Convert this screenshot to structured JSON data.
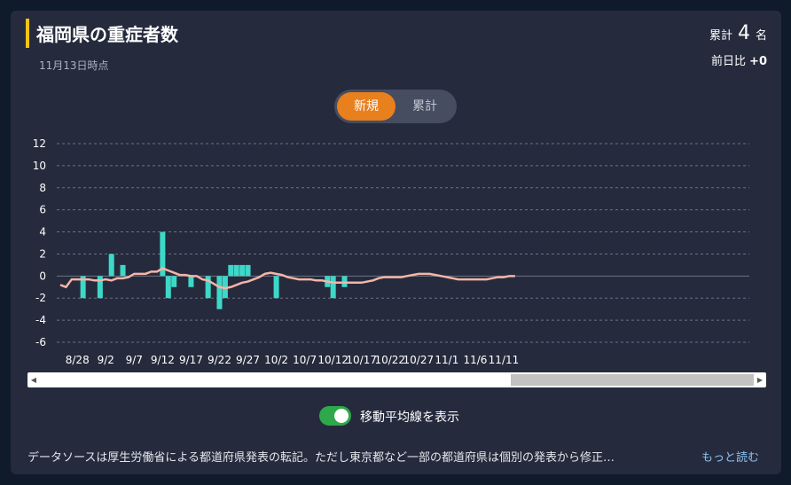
{
  "header": {
    "title": "福岡県の重症者数",
    "as_of": "11月13日時点",
    "total_label": "累計",
    "total_value": "4",
    "total_unit": "名",
    "day_diff_label": "前日比",
    "day_diff_value": "+0"
  },
  "tabs": {
    "new_label": "新規",
    "cumulative_label": "累計",
    "selected": "新規"
  },
  "moving_average": {
    "label": "移動平均線を表示",
    "enabled": true
  },
  "footer": {
    "note": "データソースは厚生労働省による都道府県発表の転記。ただし東京都など一部の都道府県は個別の発表から修正…",
    "read_more": "もっと読む"
  },
  "colors": {
    "bar": "#3dd9c8",
    "moving_average": "#f4b5a8",
    "accent": "#f0c419",
    "tab_active": "#e8801e",
    "switch_on": "#2ea84a"
  },
  "chart_data": {
    "type": "bar",
    "x_start": "8/25",
    "x_end": "11/13",
    "tick_labels": [
      "8/28",
      "9/2",
      "9/7",
      "9/12",
      "9/17",
      "9/22",
      "9/27",
      "10/2",
      "10/7",
      "10/12",
      "10/17",
      "10/22",
      "10/27",
      "11/1",
      "11/6",
      "11/11"
    ],
    "ylim": [
      -6,
      12
    ],
    "yticks": [
      -6,
      -4,
      -2,
      0,
      2,
      4,
      6,
      8,
      10,
      12
    ],
    "grid": true,
    "series": [
      {
        "type": "bar",
        "values": [
          0,
          0,
          0,
          0,
          -2,
          0,
          0,
          -2,
          0,
          2,
          0,
          1,
          0,
          0,
          0,
          0,
          0,
          0,
          4,
          -2,
          -1,
          0,
          0,
          -1,
          0,
          0,
          -2,
          0,
          -3,
          -2,
          1,
          1,
          1,
          1,
          0,
          0,
          0,
          0,
          -2,
          0,
          0,
          0,
          0,
          0,
          0,
          0,
          0,
          -1,
          -2,
          0,
          -1,
          0,
          0,
          0,
          0,
          0,
          0,
          0,
          0,
          0,
          0,
          0,
          0,
          0,
          0,
          0,
          0,
          0,
          0,
          0,
          0,
          0,
          0,
          0,
          0,
          0,
          0,
          0,
          0,
          0,
          0
        ]
      },
      {
        "type": "line",
        "values": [
          -0.8,
          -1.0,
          -0.3,
          -0.3,
          -0.3,
          -0.3,
          -0.4,
          -0.4,
          -0.3,
          -0.4,
          -0.2,
          -0.2,
          -0.1,
          0.2,
          0.2,
          0.2,
          0.4,
          0.4,
          0.7,
          0.5,
          0.3,
          0.1,
          0.1,
          0,
          0,
          -0.3,
          -0.4,
          -0.7,
          -1.0,
          -1.1,
          -1.0,
          -0.8,
          -0.6,
          -0.5,
          -0.3,
          -0.1,
          0.2,
          0.3,
          0.2,
          0.1,
          -0.1,
          -0.2,
          -0.3,
          -0.3,
          -0.3,
          -0.4,
          -0.4,
          -0.5,
          -0.6,
          -0.6,
          -0.6,
          -0.6,
          -0.6,
          -0.6,
          -0.5,
          -0.4,
          -0.2,
          -0.1,
          -0.1,
          -0.1,
          -0.1,
          0,
          0.1,
          0.2,
          0.2,
          0.2,
          0.1,
          0,
          -0.1,
          -0.2,
          -0.3,
          -0.3,
          -0.3,
          -0.3,
          -0.3,
          -0.3,
          -0.2,
          -0.1,
          -0.1,
          0,
          0
        ]
      }
    ]
  }
}
